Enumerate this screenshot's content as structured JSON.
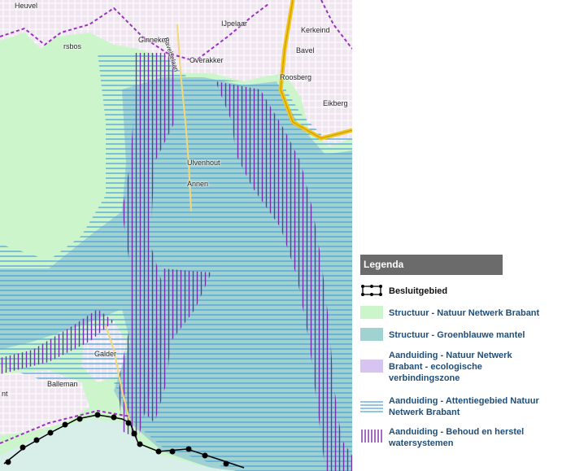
{
  "map": {
    "place_labels": [
      "Heuvel",
      "rsbos",
      "Ginneken",
      "IJpelaar",
      "Kerkeind",
      "Overakker",
      "Bavel",
      "Roosberg",
      "Eikberg",
      "Ulvenhout",
      "Annen",
      "Galder",
      "Balleman",
      "nt",
      "Bavelselaan"
    ],
    "colors": {
      "structuur_natuur": "#ccf5cc",
      "groenblauwe_mantel": "#9fd2d0",
      "ecologische_verbindingszone": "#d8c4f0",
      "attentiegebied_lines": "#4fa3d8",
      "behoud_herstel_lines": "#7a2da8",
      "urban": "#efe6ef",
      "road_major": "#f2c318",
      "boundary": "#000000"
    }
  },
  "legend": {
    "title": "Legenda",
    "items": [
      {
        "label": "Besluitgebied",
        "swatch": "boundary"
      },
      {
        "label": "Structuur - Natuur Netwerk Brabant",
        "swatch": "structuur_natuur"
      },
      {
        "label": "Structuur - Groenblauwe mantel",
        "swatch": "groenblauwe_mantel"
      },
      {
        "label": "Aanduiding - Natuur Netwerk Brabant - ecologische verbindingszone",
        "swatch": "ecologische_verbindingszone"
      },
      {
        "label": "Aanduiding - Attentiegebied Natuur Netwerk Brabant",
        "swatch": "horizontal-lines"
      },
      {
        "label": "Aanduiding - Behoud en herstel watersystemen",
        "swatch": "vertical-lines"
      }
    ]
  }
}
